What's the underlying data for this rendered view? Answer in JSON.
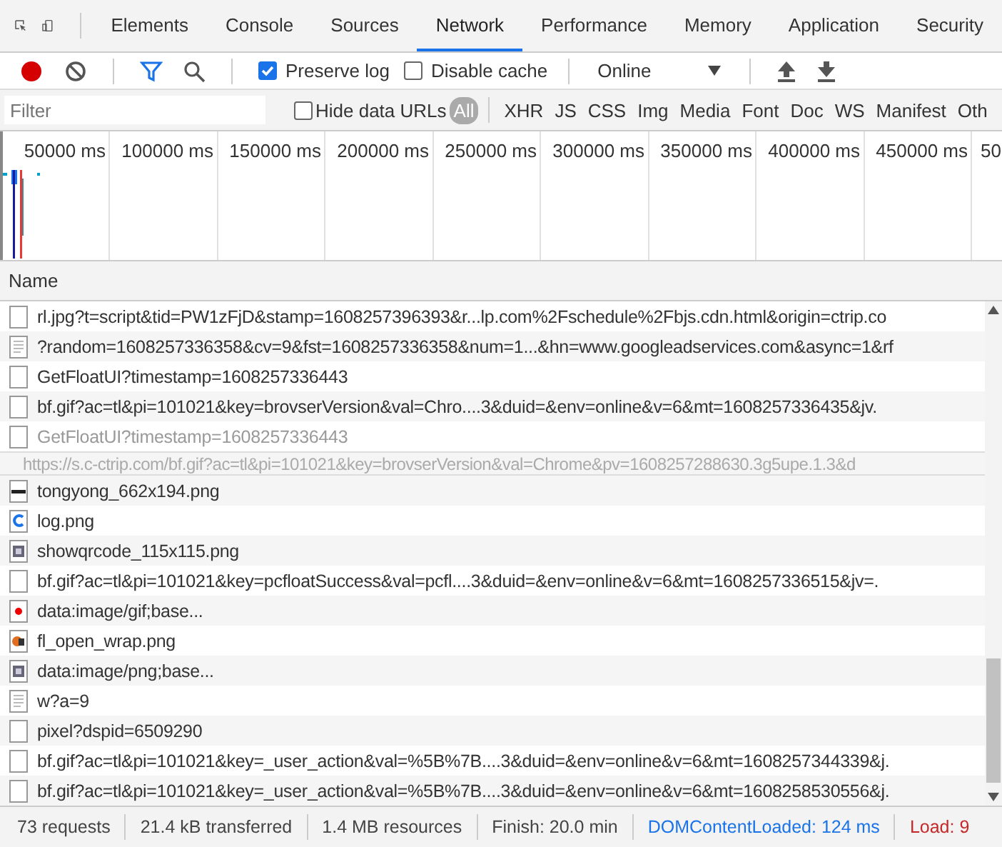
{
  "tabs": [
    {
      "label": "Elements",
      "selected": false
    },
    {
      "label": "Console",
      "selected": false
    },
    {
      "label": "Sources",
      "selected": false
    },
    {
      "label": "Network",
      "selected": true
    },
    {
      "label": "Performance",
      "selected": false
    },
    {
      "label": "Memory",
      "selected": false
    },
    {
      "label": "Application",
      "selected": false
    },
    {
      "label": "Security",
      "selected": false
    }
  ],
  "toolbar": {
    "recording": true,
    "filter_active": true,
    "preserve_log": {
      "label": "Preserve log",
      "checked": true
    },
    "disable_cache": {
      "label": "Disable cache",
      "checked": false
    },
    "throttling": "Online"
  },
  "filter_bar": {
    "placeholder": "Filter",
    "hide_data_urls": {
      "label": "Hide data URLs",
      "checked": false
    },
    "types": [
      {
        "label": "All",
        "selected": true
      },
      {
        "label": "XHR",
        "selected": false
      },
      {
        "label": "JS",
        "selected": false
      },
      {
        "label": "CSS",
        "selected": false
      },
      {
        "label": "Img",
        "selected": false
      },
      {
        "label": "Media",
        "selected": false
      },
      {
        "label": "Font",
        "selected": false
      },
      {
        "label": "Doc",
        "selected": false
      },
      {
        "label": "WS",
        "selected": false
      },
      {
        "label": "Manifest",
        "selected": false
      },
      {
        "label": "Oth",
        "selected": false
      }
    ]
  },
  "timeline": {
    "ticks": [
      "50000 ms",
      "100000 ms",
      "150000 ms",
      "200000 ms",
      "250000 ms",
      "300000 ms",
      "350000 ms",
      "400000 ms",
      "450000 ms",
      "50"
    ]
  },
  "table": {
    "column": "Name",
    "rows": [
      {
        "kind": "blank",
        "name": "rl.jpg?t=script&tid=PW1zFjD&stamp=1608257396393&r...lp.com%2Fschedule%2Fbjs.cdn.html&origin=ctrip.co",
        "dimmed": false
      },
      {
        "kind": "doc",
        "name": "?random=1608257336358&cv=9&fst=1608257336358&num=1...&hn=www.googleadservices.com&async=1&rf",
        "dimmed": false
      },
      {
        "kind": "blank",
        "name": "GetFloatUI?timestamp=1608257336443",
        "dimmed": false
      },
      {
        "kind": "blank",
        "name": "bf.gif?ac=tl&pi=101021&key=brovserVersion&val=Chro....3&duid=&env=online&v=6&mt=1608257336435&jv.",
        "dimmed": false
      },
      {
        "kind": "blank",
        "name": "GetFloatUI?timestamp=1608257336443",
        "dimmed": true,
        "tooltip": "https://s.c-ctrip.com/bf.gif?ac=tl&pi=101021&key=brovserVersion&val=Chrome&pv=1608257288630.3g5upe.1.3&d"
      },
      {
        "kind": "line",
        "name": "tongyong_662x194.png",
        "dimmed": false
      },
      {
        "kind": "logo",
        "name": "log.png",
        "dimmed": false
      },
      {
        "kind": "grid",
        "name": "showqrcode_115x115.png",
        "dimmed": false
      },
      {
        "kind": "blank",
        "name": "bf.gif?ac=tl&pi=101021&key=pcfloatSuccess&val=pcfl....3&duid=&env=online&v=6&mt=1608257336515&jv=.",
        "dimmed": false
      },
      {
        "kind": "dot",
        "name": "data:image/gif;base...",
        "dimmed": false
      },
      {
        "kind": "picture",
        "name": "fl_open_wrap.png",
        "dimmed": false
      },
      {
        "kind": "grid",
        "name": "data:image/png;base...",
        "dimmed": false
      },
      {
        "kind": "doc",
        "name": "w?a=9",
        "dimmed": false
      },
      {
        "kind": "blank",
        "name": "pixel?dspid=6509290",
        "dimmed": false
      },
      {
        "kind": "blank",
        "name": "bf.gif?ac=tl&pi=101021&key=_user_action&val=%5B%7B....3&duid=&env=online&v=6&mt=1608257344339&j.",
        "dimmed": false
      },
      {
        "kind": "blank",
        "name": "bf.gif?ac=tl&pi=101021&key=_user_action&val=%5B%7B....3&duid=&env=online&v=6&mt=1608258530556&j.",
        "dimmed": false
      }
    ]
  },
  "status_bar": [
    {
      "kind": "plain",
      "text": "73 requests"
    },
    {
      "kind": "plain",
      "text": "21.4 kB transferred"
    },
    {
      "kind": "plain",
      "text": "1.4 MB resources"
    },
    {
      "kind": "plain",
      "text": "Finish: 20.0 min"
    },
    {
      "kind": "dom",
      "text": "DOMContentLoaded: 124 ms"
    },
    {
      "kind": "load",
      "text": "Load: 9"
    }
  ]
}
